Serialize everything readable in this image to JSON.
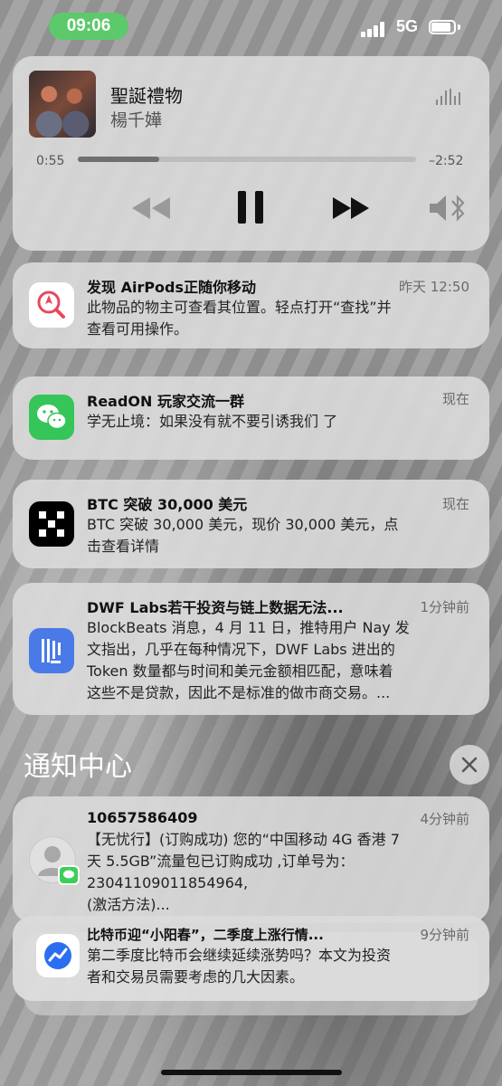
{
  "status_bar": {
    "time": "09:06",
    "network": "5G"
  },
  "now_playing": {
    "title": "聖誕禮物",
    "artist": "楊千嬅",
    "elapsed": "0:55",
    "remaining": "–2:52",
    "progress_fraction": 0.24
  },
  "notifications": [
    {
      "title": "发现 AirPods正随你移动",
      "time": "昨天 12:50",
      "body_lines": [
        "此物品的物主可查看其位置。轻点打开“查找”并",
        "查看可用操作。"
      ]
    },
    {
      "title": "ReadON 玩家交流一群",
      "time": "现在",
      "body_lines": [
        "学无止境：如果没有就不要引诱我们 了"
      ]
    },
    {
      "title": "BTC 突破 30,000 美元",
      "time": "现在",
      "body_lines": [
        "BTC 突破 30,000 美元，现价 30,000 美元，点",
        "击查看详情"
      ]
    },
    {
      "title": "DWF Labs若干投资与链上数据无法...",
      "time": "1分钟前",
      "body_lines": [
        "BlockBeats 消息，4 月 11 日，推特用户 Nay 发",
        "文指出，几乎在每种情况下，DWF Labs 进出的",
        "Token 数量都与时间和美元金额相匹配，意味着",
        "这些不是贷款，因此不是标准的做市商交易。..."
      ]
    }
  ],
  "notification_center": {
    "header": "通知中心",
    "items": [
      {
        "title": "10657586409",
        "time": "4分钟前",
        "body_lines": [
          "【无忧行】(订购成功) 您的“中国移动 4G 香港 7",
          "天 5.5GB”流量包已订购成功 ,订单号为：",
          "23041109011854964,",
          "(激活方法)..."
        ]
      },
      {
        "title": "比特币迎“小阳春”，二季度上涨行情...",
        "time": "9分钟前",
        "body_lines": [
          "第二季度比特币会继续延续涨势吗？本文为投资",
          "者和交易员需要考虑的几大因素。"
        ]
      }
    ]
  },
  "colors": {
    "time_pill": "#5cc96a",
    "wechat_green": "#35c558",
    "dwf_blue": "#4a7ae8",
    "findmy_red": "#e8485e"
  },
  "icons": [
    "cellular-signal-icon",
    "battery-icon",
    "sound-wave-icon",
    "rewind-icon",
    "pause-icon",
    "fast-forward-icon",
    "speaker-bluetooth-icon",
    "find-my-icon",
    "wechat-icon",
    "okx-icon",
    "dwf-app-icon",
    "contact-avatar-icon",
    "messages-badge-icon",
    "news-chart-icon",
    "close-icon"
  ]
}
